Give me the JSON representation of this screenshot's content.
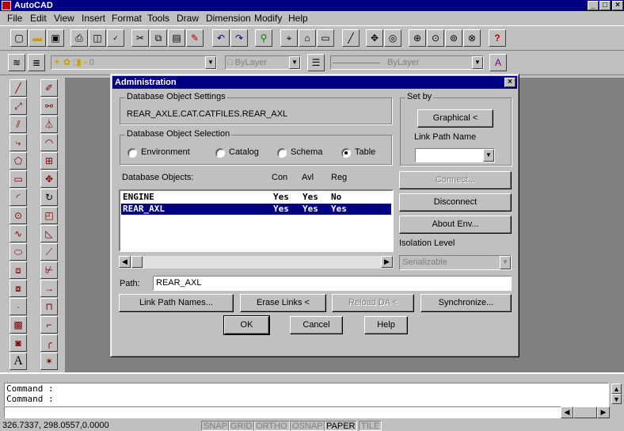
{
  "window": {
    "title": "AutoCAD",
    "min": "_",
    "max": "□",
    "close": "×"
  },
  "menu": [
    "File",
    "Edit",
    "View",
    "Insert",
    "Format",
    "Tools",
    "Draw",
    "Dimension",
    "Modify",
    "Help"
  ],
  "layer_toolbar": {
    "layer_value": "0",
    "color_value": "ByLayer",
    "linetype_value": "ByLayer"
  },
  "dialog": {
    "title": "Administration",
    "settings_group": "Database Object Settings",
    "settings_value": "REAR_AXLE.CAT.CATFILES.REAR_AXL",
    "selection_group": "Database Object Selection",
    "radios": [
      "Environment",
      "Catalog",
      "Schema",
      "Table"
    ],
    "selected_radio": "Table",
    "setby_group": "Set by",
    "graphical_button": "Graphical <",
    "link_path_name_label": "Link Path Name",
    "db_objects_label": "Database Objects:",
    "columns": [
      "Con",
      "Avl",
      "Reg"
    ],
    "rows": [
      {
        "name": "ENGINE",
        "con": "Yes",
        "avl": "Yes",
        "reg": "No",
        "selected": false
      },
      {
        "name": "REAR_AXL",
        "con": "Yes",
        "avl": "Yes",
        "reg": "Yes",
        "selected": true
      }
    ],
    "connect_button": "Connect...",
    "disconnect_button": "Disconnect",
    "about_env_button": "About Env...",
    "isolation_label": "Isolation Level",
    "isolation_value": "Serializable",
    "path_label": "Path:",
    "path_value": "REAR_AXL",
    "link_path_names_button": "Link Path Names...",
    "erase_links_button": "Erase Links <",
    "reload_da_button": "Reload DA <",
    "synchronize_button": "Synchronize...",
    "ok_button": "OK",
    "cancel_button": "Cancel",
    "help_button": "Help"
  },
  "command": {
    "line1": "Command :",
    "line2": "Command :"
  },
  "status": {
    "coords": "326.7337, 298.0557,0.0000",
    "modes": [
      "SNAP",
      "GRID",
      "ORTHO",
      "OSNAP",
      "PAPER",
      "TILE"
    ],
    "active_mode": "PAPER"
  },
  "colors": {
    "titlebar": "#000080",
    "face": "#c0c0c0",
    "drawing": "#808080",
    "selection": "#000080"
  }
}
